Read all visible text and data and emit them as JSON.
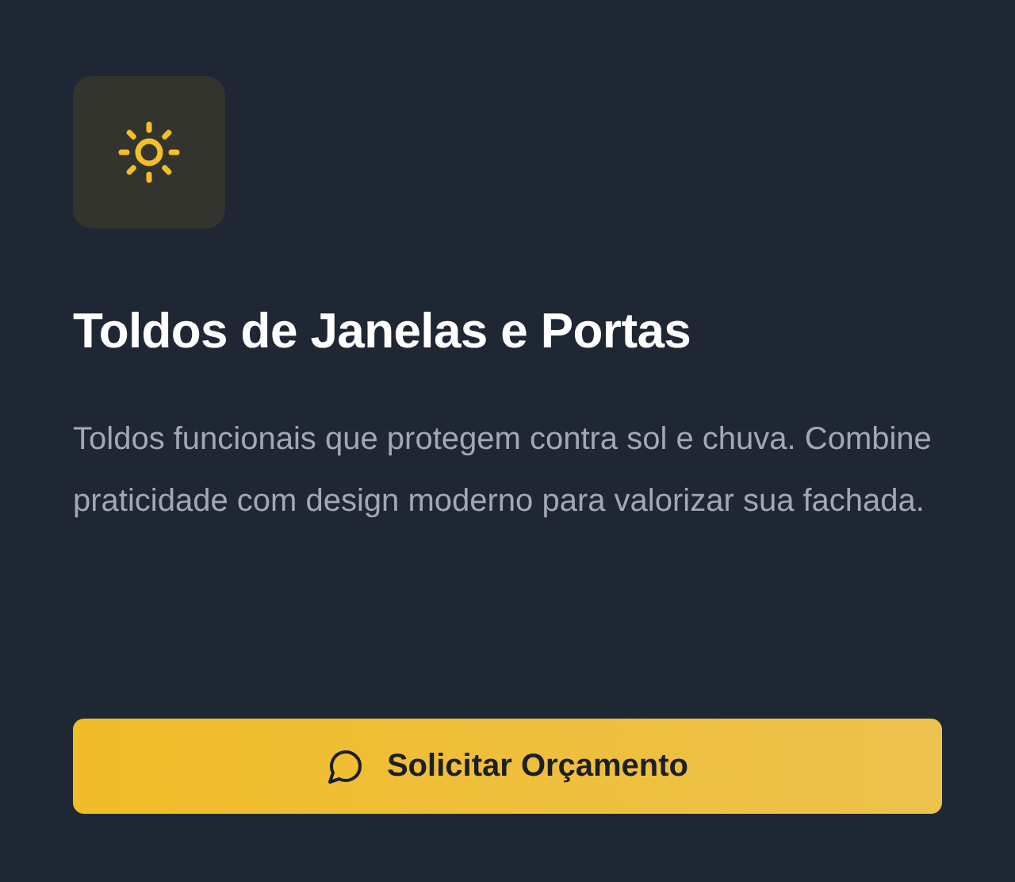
{
  "card": {
    "title": "Toldos de Janelas e Portas",
    "description": "Toldos funcionais que protegem contra sol e chuva. Combine praticidade com design moderno para valorizar sua fachada.",
    "button": {
      "label": "Solicitar Orçamento"
    }
  }
}
